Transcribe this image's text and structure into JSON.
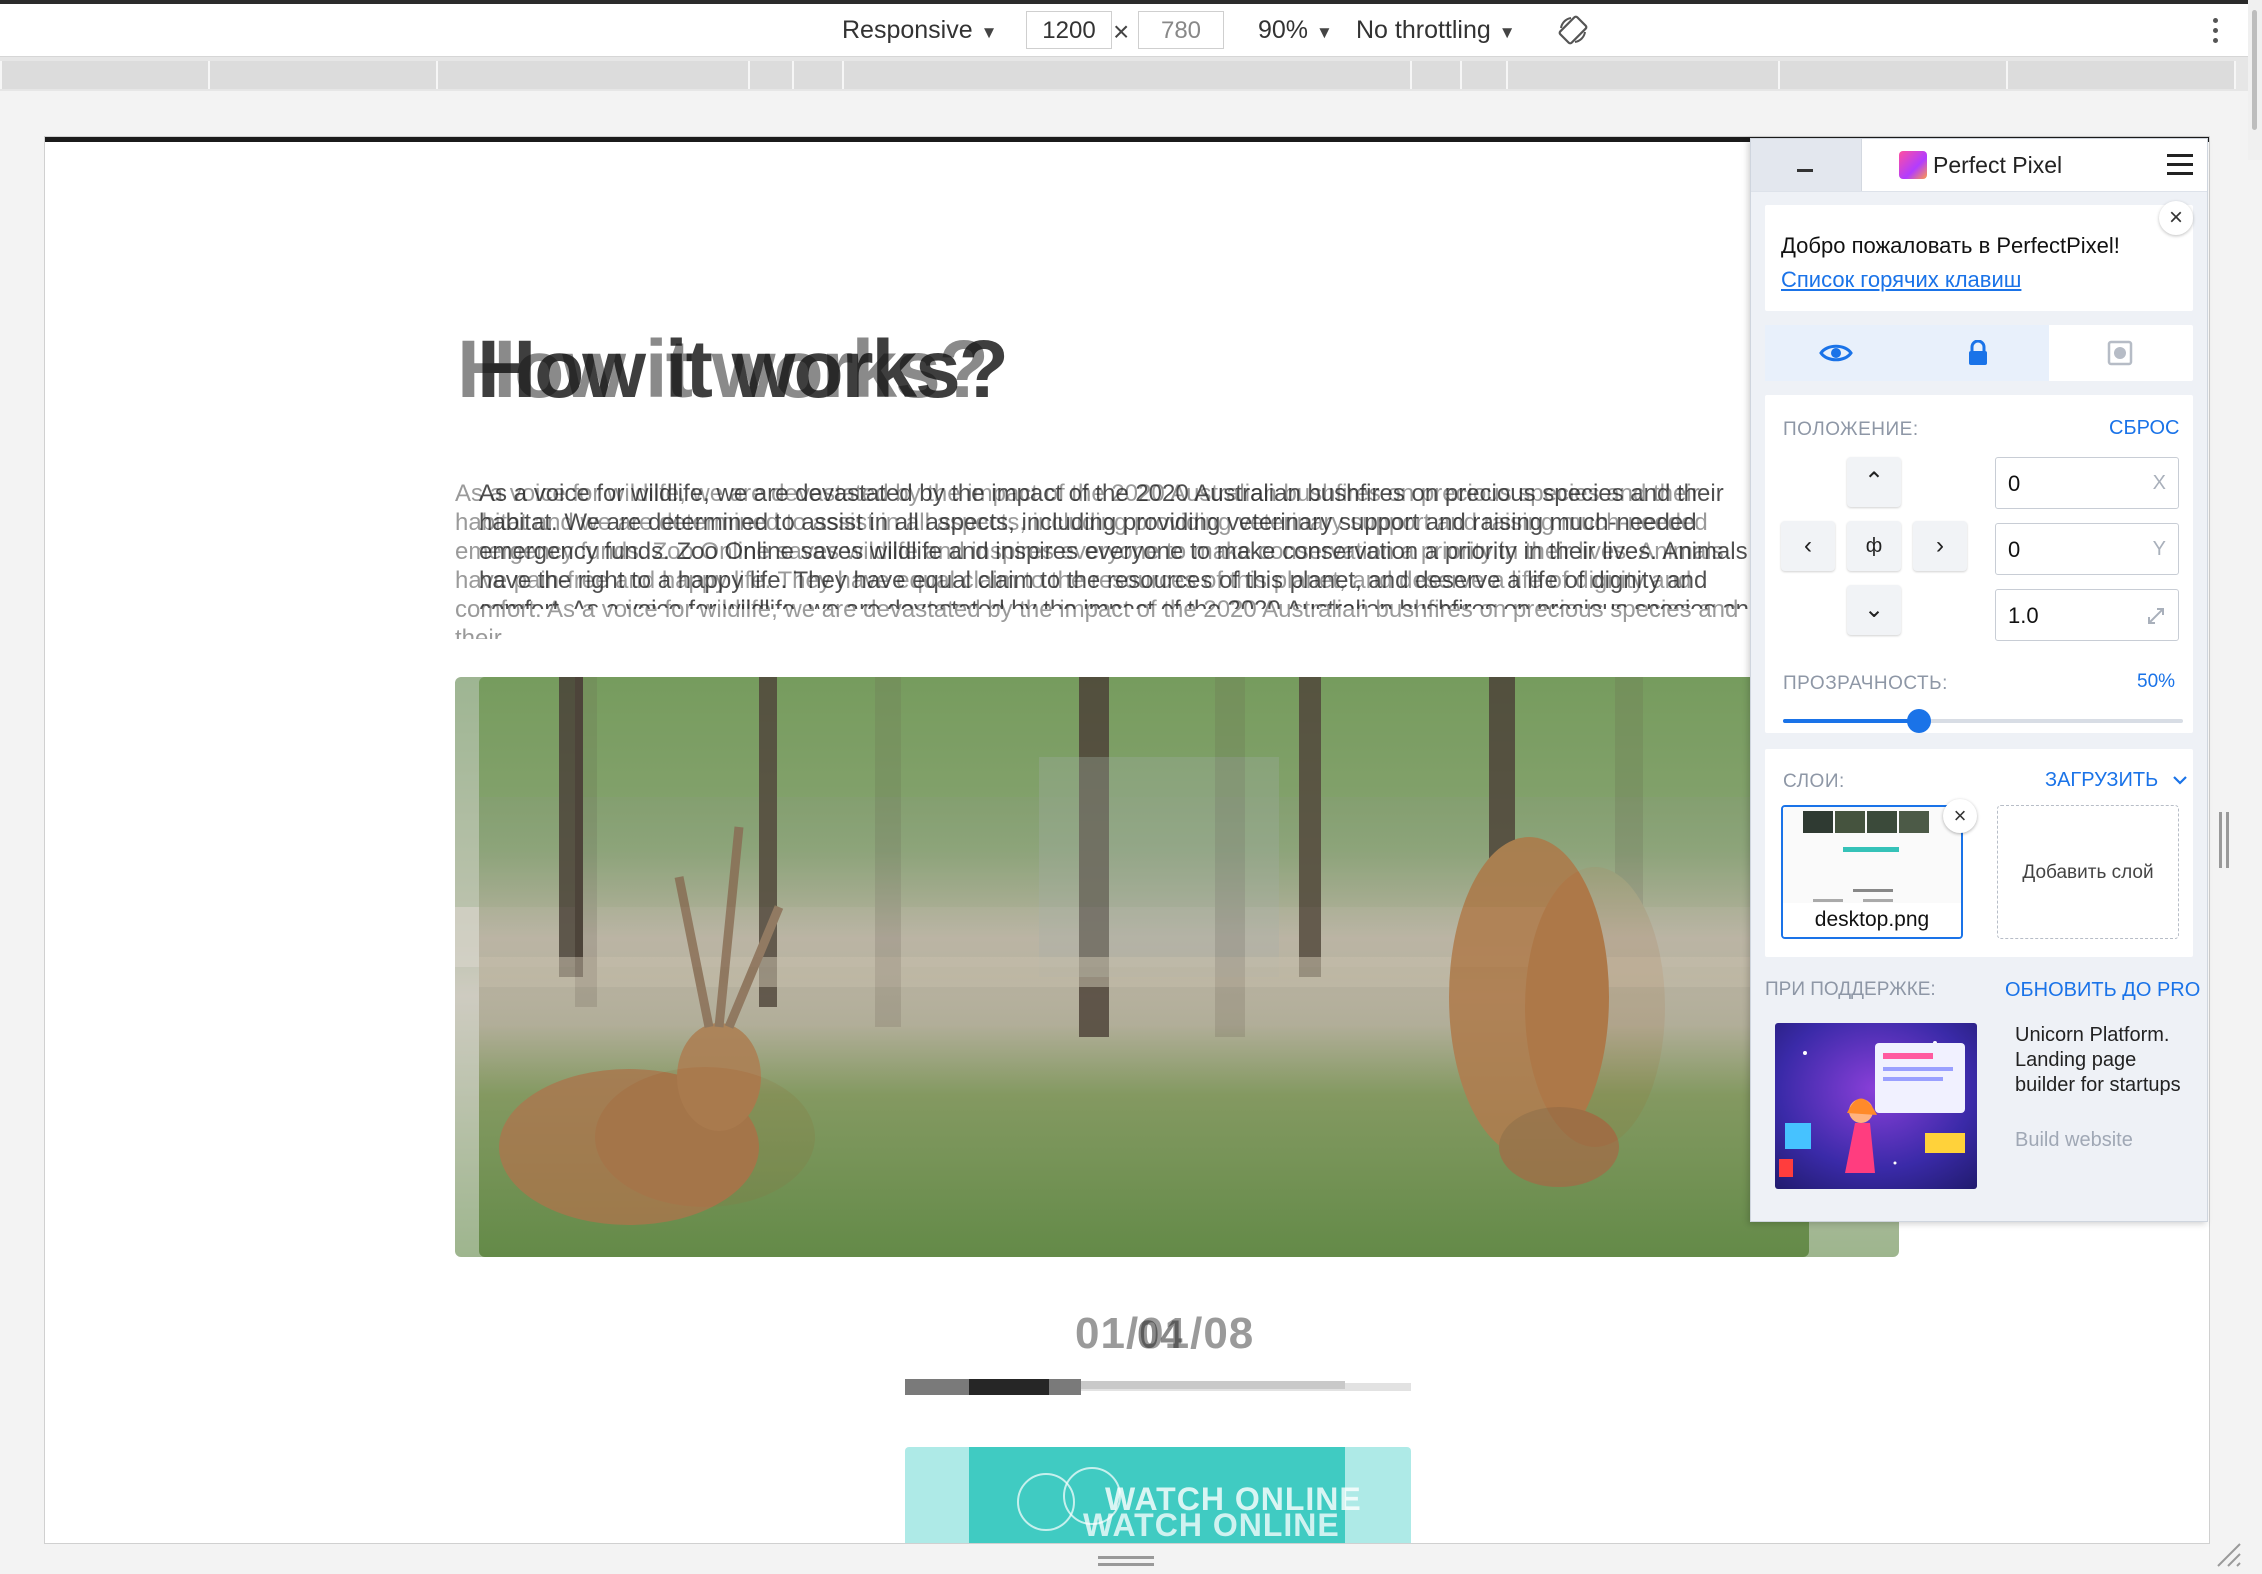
{
  "toolbar": {
    "device": "Responsive",
    "width": "1200",
    "height": "780",
    "size_separator": "×",
    "zoom": "90%",
    "throttling": "No throttling"
  },
  "page": {
    "heading": "How it works?",
    "heading_overlay": "How it works?",
    "paragraph": "As a voice for wildlife, we are devastated by the impact of the 2020 Australian bushfires on precious species and their habitat. We are determined to assist in all aspects, including providing veterinary support and raising much-needed emergency funds. Zoo Online saves wildlife and inspires everyone to make conservation a priority in their lives. Animals have the right to a happy life. They have equal claim to the resources of this planet, and deserve a life of dignity and comfort. As a voice for wildlife, we are devastated by the impact of the 2020 Australian bushfires on precious species and their habitat.",
    "paragraph_overlay": "As a voice for wildlife, we are devastated by the impact of the 2020 Australian bushfires on precious species and their habitat and we are determined to assist in all aspects, including providing veterinary support and raising much-needed emergency funds. Zoo Online saves wildlife and inspires everyone to make conservation a priority in their lives. Animals have pain-free and happy life. They have equal claim to the resources of this planet, and deserve a life of dignity and comfort. As a voice for wildlife, we are devastated by the impact of the 2020 Australian bushfires on precious species and their",
    "date": "01/01/08",
    "date_overlay": "04",
    "watch_label": "WATCH ONLINE",
    "watch_label_overlay": "WATCH ONLINE"
  },
  "perfect_pixel": {
    "title": "Perfect Pixel",
    "welcome": "Добро пожаловать в PerfectPixel!",
    "hotkeys_link": "Список горячих клавиш",
    "position_label": "ПОЛОЖЕНИЕ:",
    "reset_label": "СБРОС",
    "x_value": "0",
    "x_unit": "X",
    "y_value": "0",
    "y_unit": "Y",
    "scale_value": "1.0",
    "opacity_label": "ПРОЗРАЧНОСТЬ:",
    "opacity_value": "50%",
    "opacity_fraction": 0.5,
    "layers_label": "СЛОИ:",
    "upload_label": "ЗАГРУЗИТЬ",
    "layer_name": "desktop.png",
    "add_layer": "Добавить слой",
    "sponsor_label": "ПРИ ПОДДЕРЖКЕ:",
    "upgrade_label": "ОБНОВИТЬ ДО PRO",
    "promo_text": "Unicorn Platform. Landing page builder for startups",
    "promo_sub": "Build website"
  },
  "colors": {
    "accent": "#1a73e8",
    "teal": "#2bc4ba"
  }
}
